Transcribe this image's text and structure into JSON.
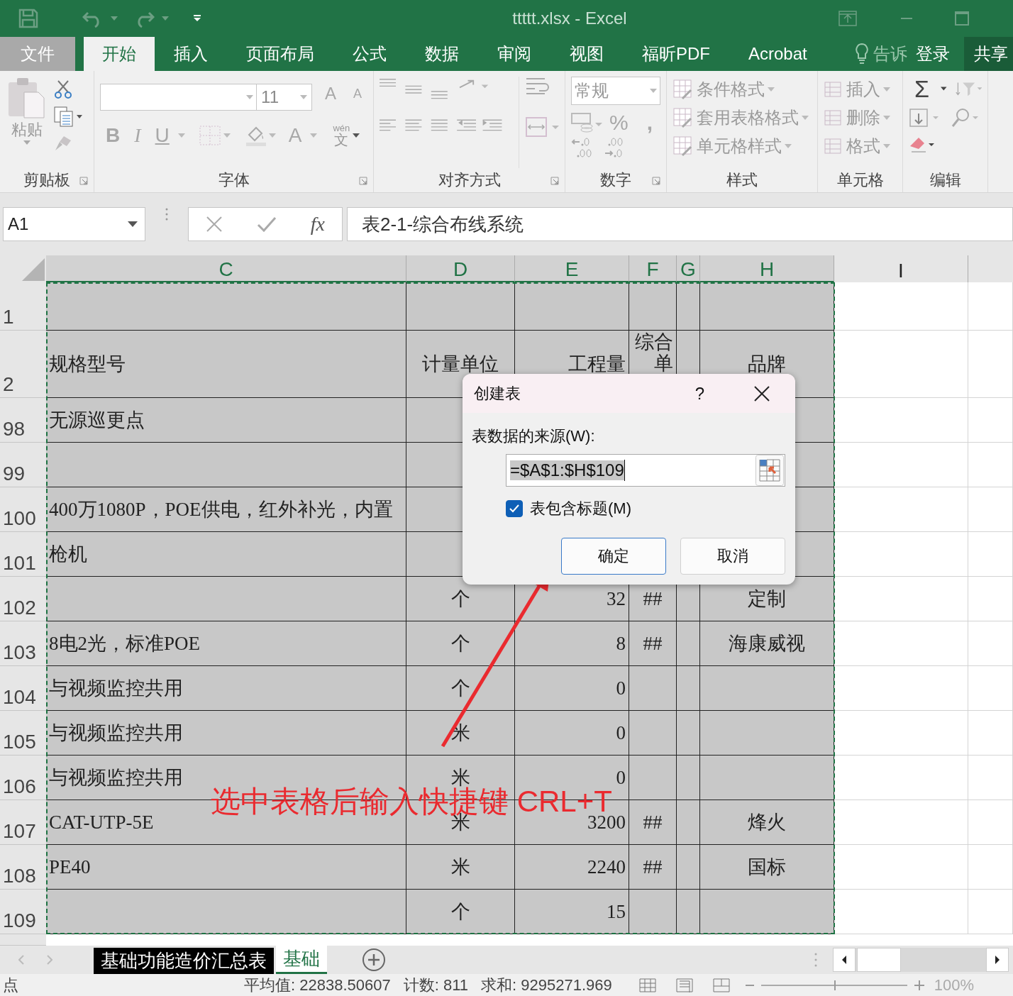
{
  "window": {
    "title": "ttttt.xlsx - Excel"
  },
  "tabs": [
    {
      "label": "文件",
      "kind": "file",
      "selected": false
    },
    {
      "label": "开始",
      "kind": "tab",
      "selected": true
    },
    {
      "label": "插入",
      "kind": "tab",
      "selected": false
    },
    {
      "label": "页面布局",
      "kind": "tab",
      "selected": false
    },
    {
      "label": "公式",
      "kind": "tab",
      "selected": false
    },
    {
      "label": "数据",
      "kind": "tab",
      "selected": false
    },
    {
      "label": "审阅",
      "kind": "tab",
      "selected": false
    },
    {
      "label": "视图",
      "kind": "tab",
      "selected": false
    },
    {
      "label": "福昕PDF",
      "kind": "tab",
      "selected": false
    },
    {
      "label": "Acrobat",
      "kind": "tab",
      "selected": false
    }
  ],
  "tell_me": "告诉",
  "sign_in": "登录",
  "share": "共享",
  "ribbon": {
    "clipboard": {
      "label": "剪贴板",
      "paste": "粘贴"
    },
    "font": {
      "label": "字体",
      "size": "11",
      "grow": "A",
      "shrink": "A",
      "bold": "B",
      "italic": "I",
      "underline": "U",
      "font_color": "A",
      "phonetic_top": "wén",
      "phonetic": "文"
    },
    "alignment": {
      "label": "对齐方式"
    },
    "number": {
      "label": "数字",
      "format": "常规",
      "percent": "%",
      "comma": ","
    },
    "styles": {
      "label": "样式",
      "items": [
        "条件格式",
        "套用表格格式",
        "单元格样式"
      ]
    },
    "cells": {
      "label": "单元格",
      "items": [
        "插入",
        "删除",
        "格式"
      ]
    },
    "editing": {
      "label": "编辑",
      "sum": "Σ"
    }
  },
  "formula_bar": {
    "name_box": "A1",
    "fx": "fx",
    "formula": "表2-1-综合布线系统"
  },
  "columns": [
    {
      "label": "C",
      "selected": true
    },
    {
      "label": "D",
      "selected": true
    },
    {
      "label": "E",
      "selected": true
    },
    {
      "label": "F",
      "selected": true
    },
    {
      "label": "G",
      "selected": true
    },
    {
      "label": "H",
      "selected": true
    },
    {
      "label": "I",
      "selected": false
    }
  ],
  "rows": [
    {
      "header": "1"
    },
    {
      "header": "2",
      "C": "规格型号",
      "D": "计量单位",
      "E": "工程量",
      "F": "综合单",
      "H": "品牌"
    },
    {
      "header": "98",
      "C": "无源巡更点"
    },
    {
      "header": "99"
    },
    {
      "header": "100",
      "C": "400万1080P，POE供电，红外补光，内置"
    },
    {
      "header": "101",
      "C": "枪机"
    },
    {
      "header": "102",
      "D": "个",
      "E": "32",
      "F": "##",
      "H": "定制"
    },
    {
      "header": "103",
      "C": "8电2光，标准POE",
      "D": "个",
      "E": "8",
      "F": "##",
      "H": "海康威视"
    },
    {
      "header": "104",
      "C": "与视频监控共用",
      "D": "个",
      "E": "0"
    },
    {
      "header": "105",
      "C": "与视频监控共用",
      "D": "米",
      "E": "0"
    },
    {
      "header": "106",
      "C": "与视频监控共用",
      "D": "米",
      "E": "0"
    },
    {
      "header": "107",
      "C": "CAT-UTP-5E",
      "D": "米",
      "E": "3200",
      "F": "##",
      "H": "烽火"
    },
    {
      "header": "108",
      "C": "PE40",
      "D": "米",
      "E": "2240",
      "F": "##",
      "H": "国标"
    },
    {
      "header": "109",
      "D": "个",
      "E": "15"
    }
  ],
  "annotation": "选中表格后输入快捷键 CRL+T",
  "dialog": {
    "title": "创建表",
    "help": "?",
    "source_label": "表数据的来源(W):",
    "source_value": "=$A$1:$H$109",
    "has_headers": {
      "label": "表包含标题(M)",
      "checked": true
    },
    "ok": "确定",
    "cancel": "取消"
  },
  "sheet_tabs": [
    {
      "label": "基础功能造价汇总表",
      "selected": false
    },
    {
      "label": "基础",
      "selected": true
    }
  ],
  "status_bar": {
    "mode": "点",
    "average": "平均值: 22838.50607",
    "count": "计数: 811",
    "sum": "求和: 9295271.969",
    "zoom_slider": {
      "level": 0.5
    },
    "zoom": "100%"
  }
}
